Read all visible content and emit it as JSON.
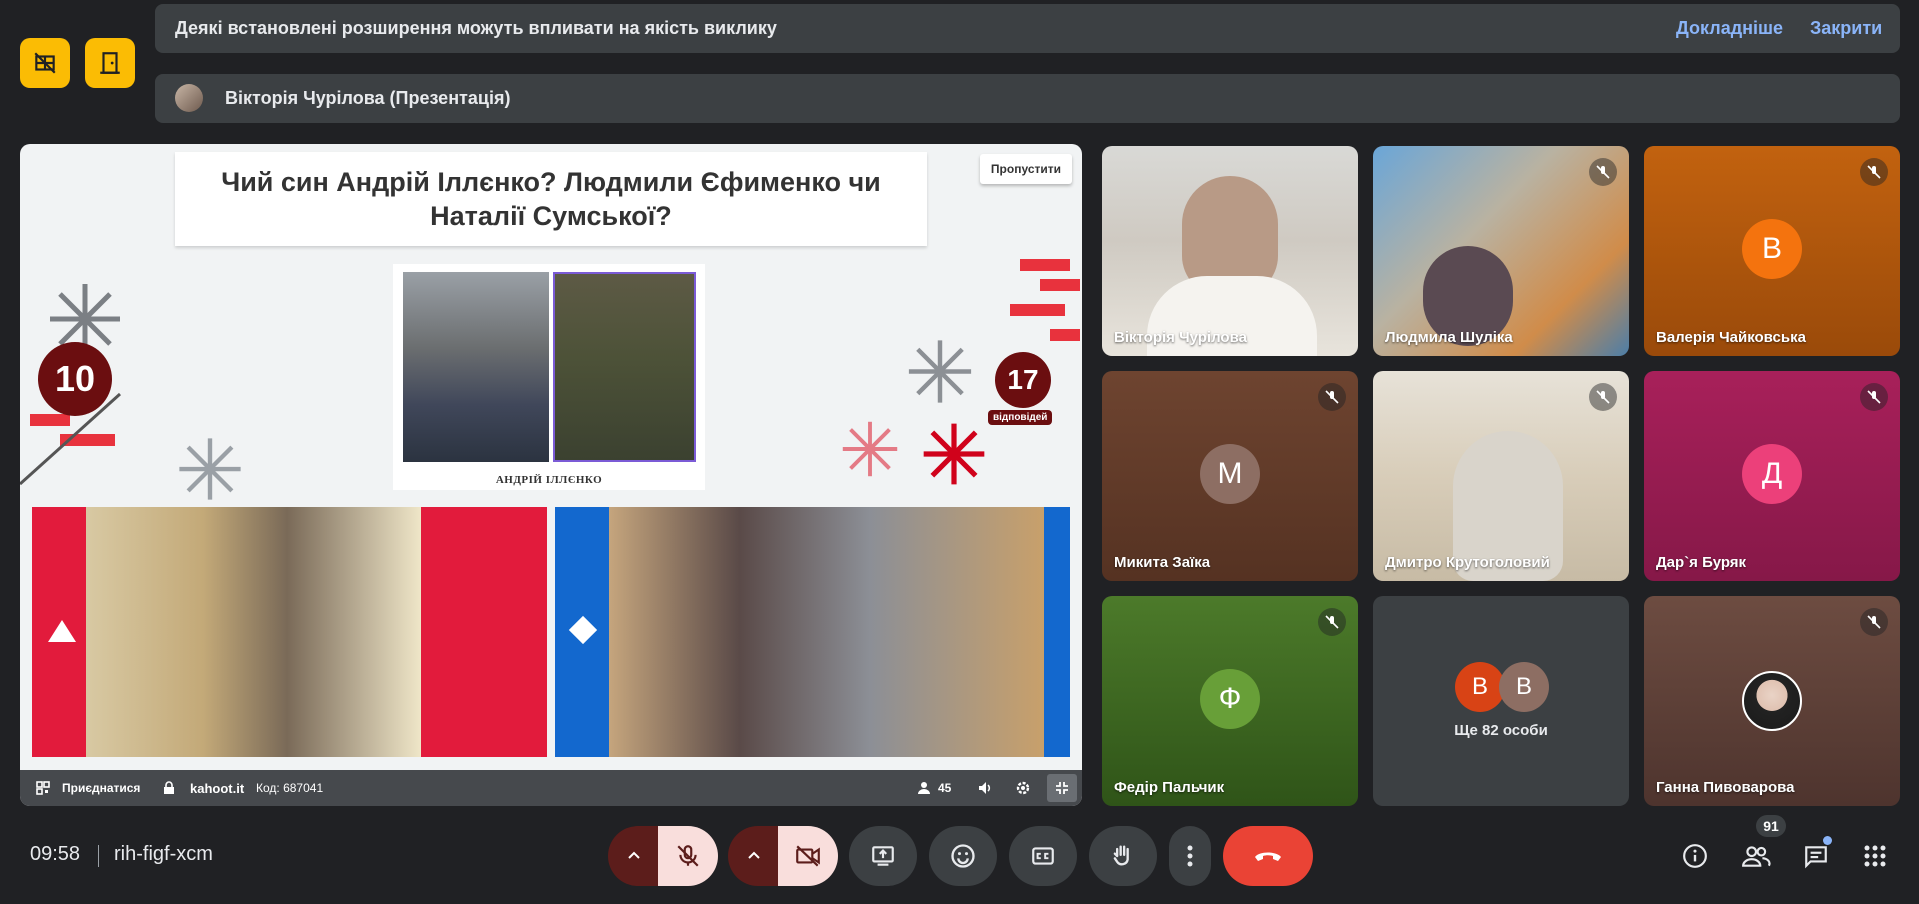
{
  "notice": {
    "message": "Деякі встановлені розширення можуть впливати на якість виклику",
    "learn_more": "Докладніше",
    "close": "Закрити"
  },
  "presenter": {
    "label": "Вікторія Чурілова (Презентація)"
  },
  "quiz": {
    "question": "Чий син Андрій Іллєнко? Людмили Єфименко чи Наталії Сумської?",
    "skip": "Пропустити",
    "timer": "10",
    "answers_count": "17",
    "answers_label": "відповідей",
    "photo_caption": "АНДРІЙ ІЛЛЄНКО",
    "bar": {
      "join": "Приєднатися",
      "site": "kahoot.it",
      "code": "Код: 687041",
      "players": "45"
    }
  },
  "participants": [
    {
      "name": "Вікторія Чурілова",
      "type": "video",
      "muted": false
    },
    {
      "name": "Людмила Шуліка",
      "type": "video",
      "muted": true
    },
    {
      "name": "Валерія Чайковська",
      "type": "avatar",
      "initial": "В",
      "muted": true
    },
    {
      "name": "Микита Заїка",
      "type": "avatar",
      "initial": "М",
      "muted": true
    },
    {
      "name": "Дмитро Крутоголовий",
      "type": "video",
      "muted": true
    },
    {
      "name": "Дар`я Буряк",
      "type": "avatar",
      "initial": "Д",
      "muted": true
    },
    {
      "name": "Федір Пальчик",
      "type": "avatar",
      "initial": "Ф",
      "muted": true
    },
    {
      "name": "Ще 82 особи",
      "type": "more",
      "initials": [
        "В",
        "В"
      ],
      "muted": false
    },
    {
      "name": "Ганна Пивоварова",
      "type": "photo",
      "muted": true
    }
  ],
  "bottom": {
    "time": "09:58",
    "meeting_code": "rih-figf-xcm",
    "people_count": "91"
  },
  "colors": {
    "accent_yellow": "#fbbc04",
    "hangup_red": "#ea4335",
    "link_blue": "#8ab4f8",
    "kahoot_red": "#e21b3c",
    "kahoot_blue": "#1368ce"
  }
}
